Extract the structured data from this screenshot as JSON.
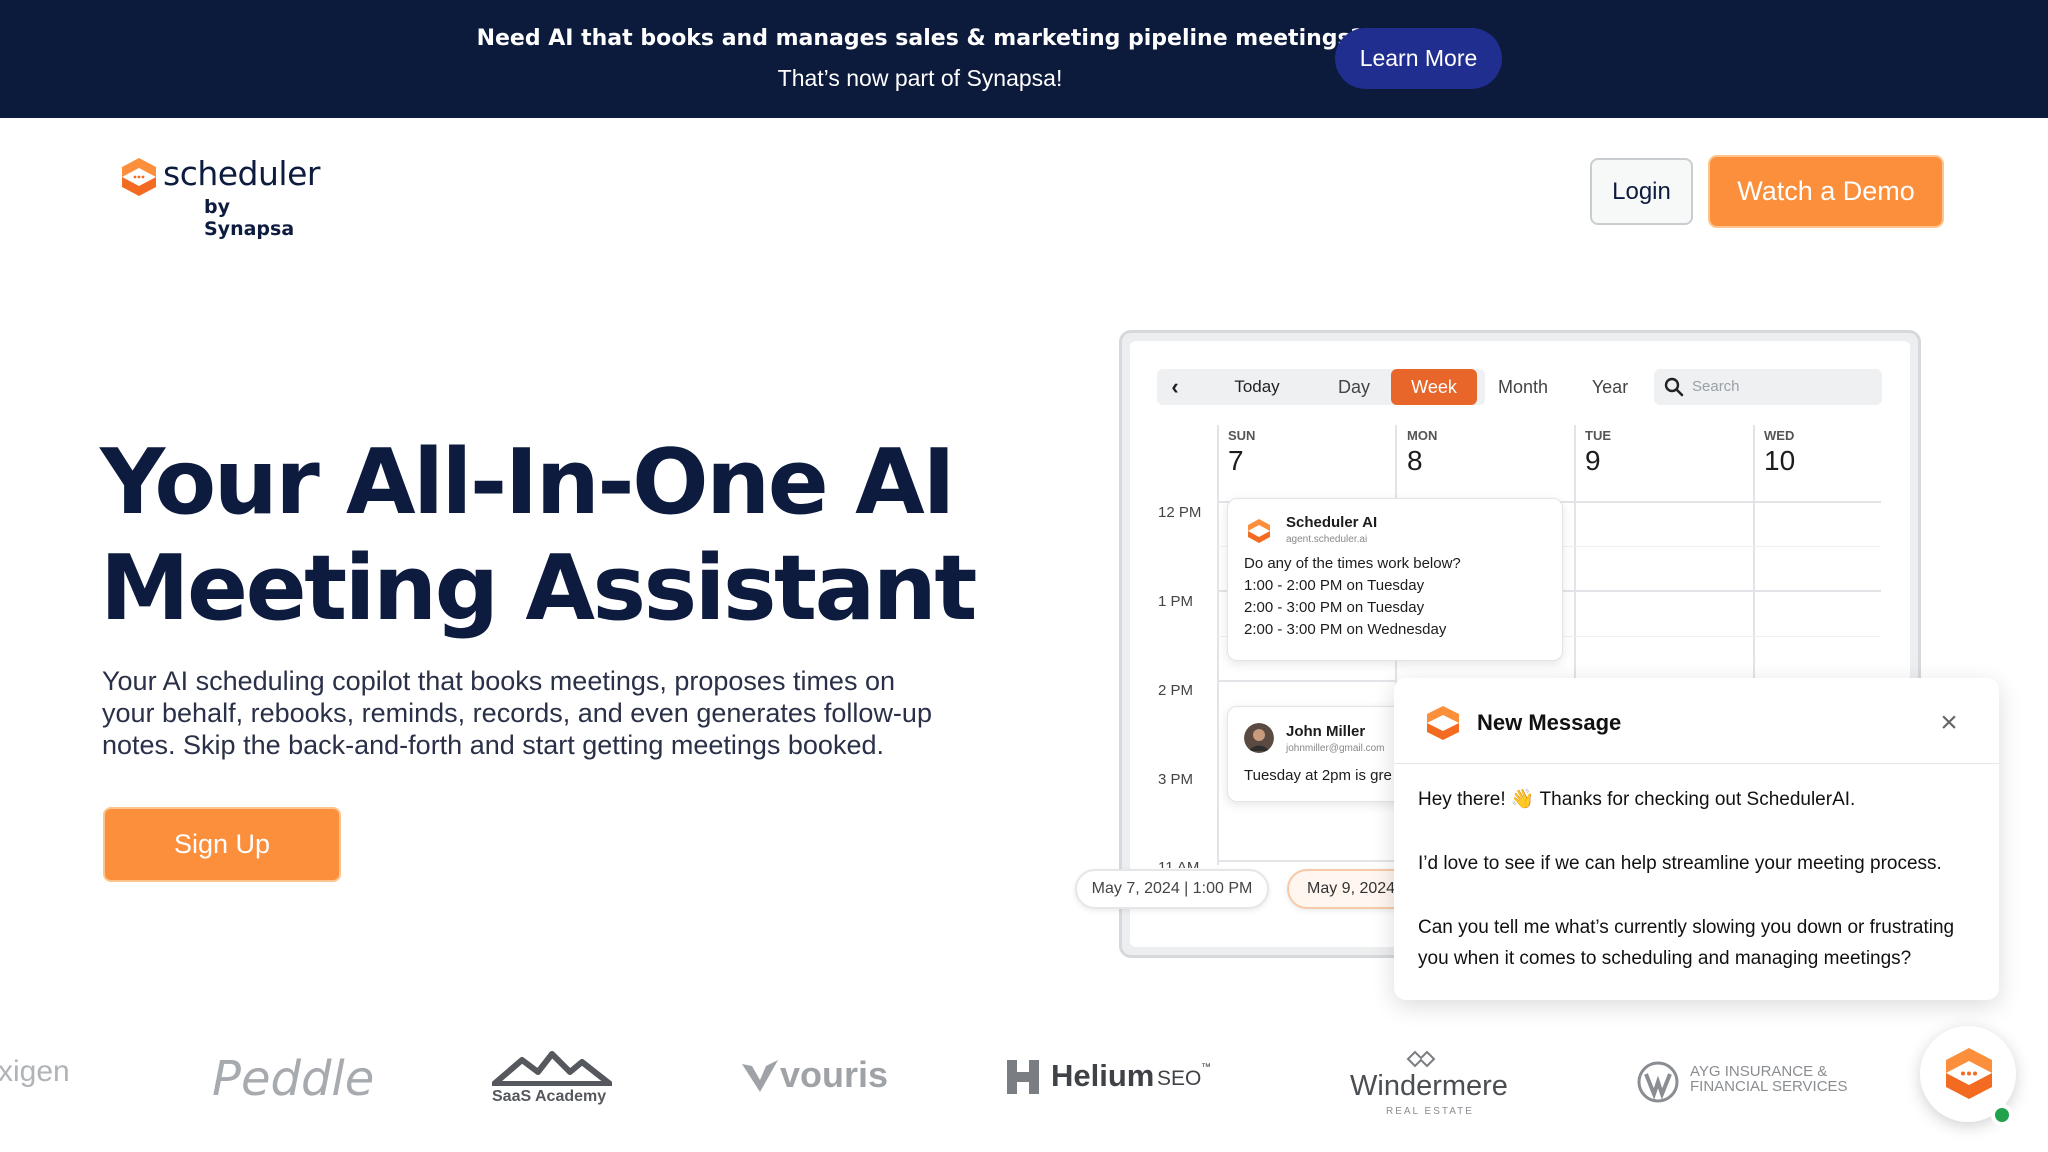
{
  "banner": {
    "title": "Need AI that books and manages sales & marketing pipeline meetings?",
    "subtitle": "That’s now part of Synapsa!",
    "learn_more": "Learn More"
  },
  "header": {
    "logo_name": "scheduler",
    "logo_by": "by Synapsa",
    "login": "Login",
    "watch_demo": "Watch a Demo"
  },
  "hero": {
    "title_line1": "Your All-In-One AI",
    "title_line2": "Meeting Assistant",
    "subtitle_line1": "Your AI scheduling copilot that books meetings, proposes times on",
    "subtitle_line2": "your behalf, rebooks, reminds, records, and even generates follow-up",
    "subtitle_line3": "notes. Skip the back-and-forth and start getting meetings booked.",
    "signup": "Sign Up"
  },
  "calendar": {
    "today": "Today",
    "views": [
      "Day",
      "Week",
      "Month",
      "Year"
    ],
    "active_view": "Week",
    "search_placeholder": "Search",
    "days": [
      {
        "name": "SUN",
        "num": "7"
      },
      {
        "name": "MON",
        "num": "8"
      },
      {
        "name": "TUE",
        "num": "9"
      },
      {
        "name": "WED",
        "num": "10"
      }
    ],
    "times": [
      "12 PM",
      "1 PM",
      "2 PM",
      "3 PM",
      "11 AM"
    ],
    "event_ai": {
      "name": "Scheduler AI",
      "email": "agent.scheduler.ai",
      "lines": [
        "Do any of the times work below?",
        "1:00 - 2:00 PM on Tuesday",
        "2:00 - 3:00 PM on Tuesday",
        "2:00 - 3:00 PM on Wednesday"
      ]
    },
    "event_john": {
      "name": "John Miller",
      "email": "johnmiller@gmail.com",
      "text": "Tuesday at 2pm is gre"
    },
    "pill_1": "May 7, 2024 | 1:00 PM",
    "pill_2": "May 9, 2024"
  },
  "chat": {
    "title": "New Message",
    "msg1": "Hey there! 👋 Thanks for checking out SchedulerAI.",
    "msg2": "I’d love to see if we can help streamline your meeting process.",
    "msg3": "Can you tell me what’s currently slowing you down or frustrating you when it comes to scheduling and managing meetings?"
  },
  "logos": {
    "oxygen": "xigen",
    "peddle": "Peddle",
    "saas_academy": "SaaS Academy",
    "vouris": "vouris",
    "helium": "Helium",
    "helium_seo": "SEO",
    "helium_tm": "™",
    "windermere": "Windermere",
    "windermere_sub": "REAL ESTATE",
    "ayg_line1": "AYG INSURANCE &",
    "ayg_line2": "FINANCIAL SERVICES"
  },
  "colors": {
    "banner_bg": "#0c1a3c",
    "learn_more_bg": "#1f2e8f",
    "accent_orange": "#fb8f3c",
    "week_active": "#e8662a",
    "navy_text": "#0d1b3e",
    "online": "#22a24a"
  }
}
